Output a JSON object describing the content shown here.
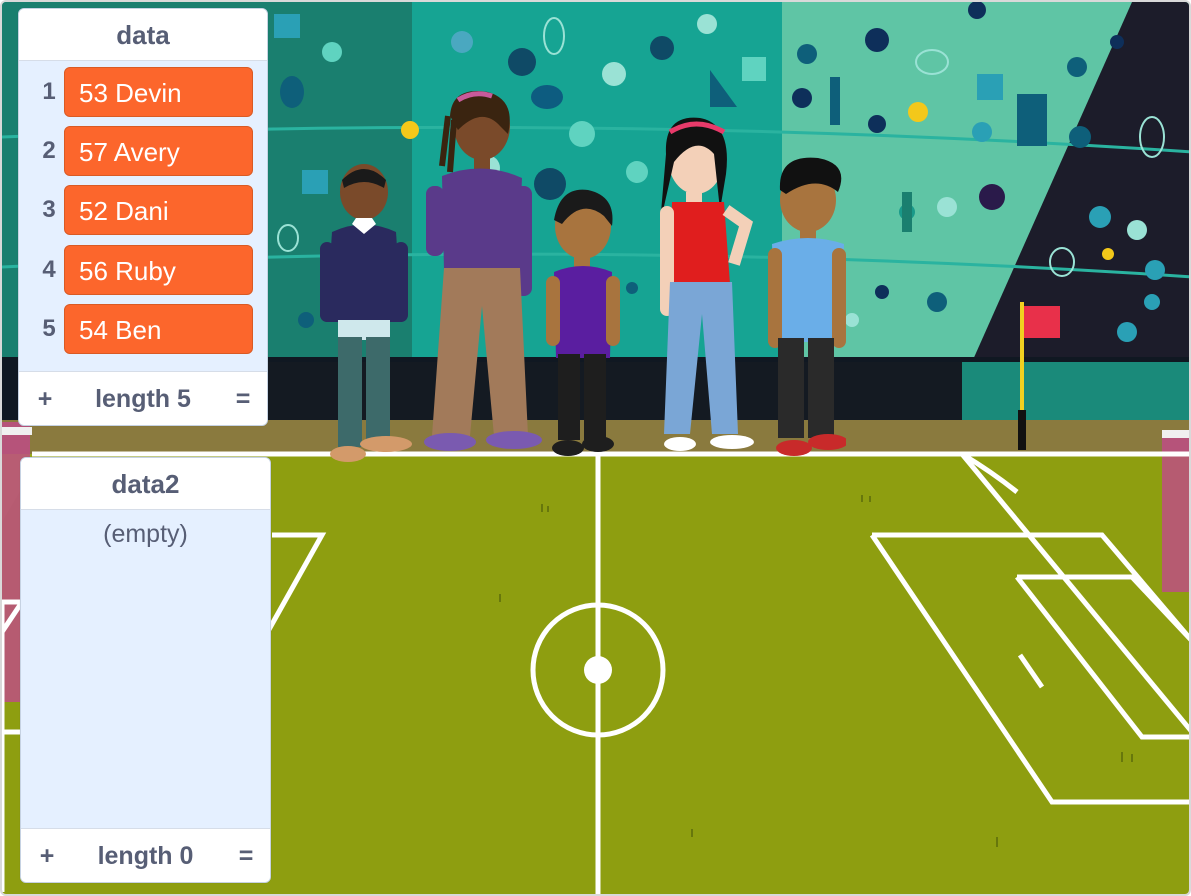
{
  "lists": [
    {
      "name": "data",
      "items": [
        {
          "index": "1",
          "value": "53 Devin"
        },
        {
          "index": "2",
          "value": "57 Avery"
        },
        {
          "index": "3",
          "value": "52 Dani"
        },
        {
          "index": "4",
          "value": "56 Ruby"
        },
        {
          "index": "5",
          "value": "54 Ben"
        }
      ],
      "add_label": "+",
      "length_label": "length 5",
      "resize_label": "="
    },
    {
      "name": "data2",
      "empty_label": "(empty)",
      "add_label": "+",
      "length_label": "length 0",
      "resize_label": "="
    }
  ],
  "colors": {
    "list_item": "#fc662c",
    "monitor_bg": "#e5f0ff",
    "text": "#575e75",
    "pitch": "#8e9e10",
    "wall_teal": "#1a9a8a"
  },
  "sprites": [
    "devin",
    "avery",
    "dani",
    "ruby",
    "ben",
    "corner-flag"
  ]
}
